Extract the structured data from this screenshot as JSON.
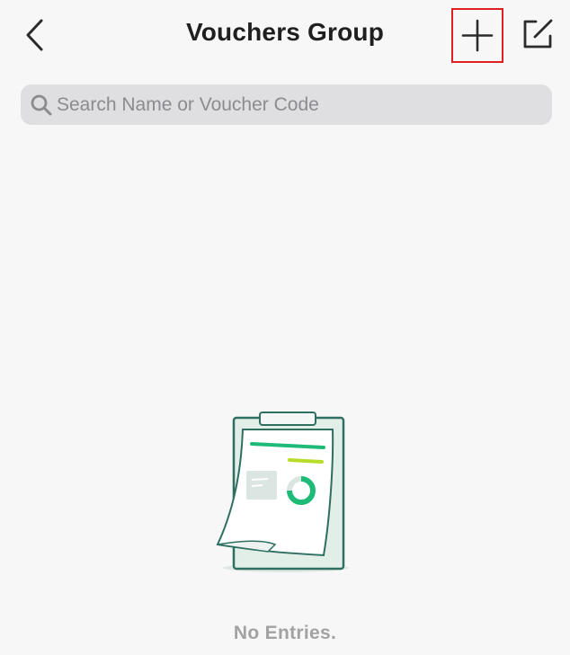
{
  "header": {
    "title": "Vouchers Group",
    "back_icon": "chevron-left-icon",
    "add_icon": "plus-icon",
    "edit_icon": "compose-icon",
    "highlight_color": "#e02020"
  },
  "search": {
    "placeholder": "Search Name or Voucher Code",
    "value": "",
    "icon": "search-icon"
  },
  "empty_state": {
    "illustration": "clipboard-document-illustration",
    "message": "No Entries.",
    "accent_colors": [
      "#1dbb77",
      "#b7dd2a",
      "#2e7d6b"
    ]
  }
}
